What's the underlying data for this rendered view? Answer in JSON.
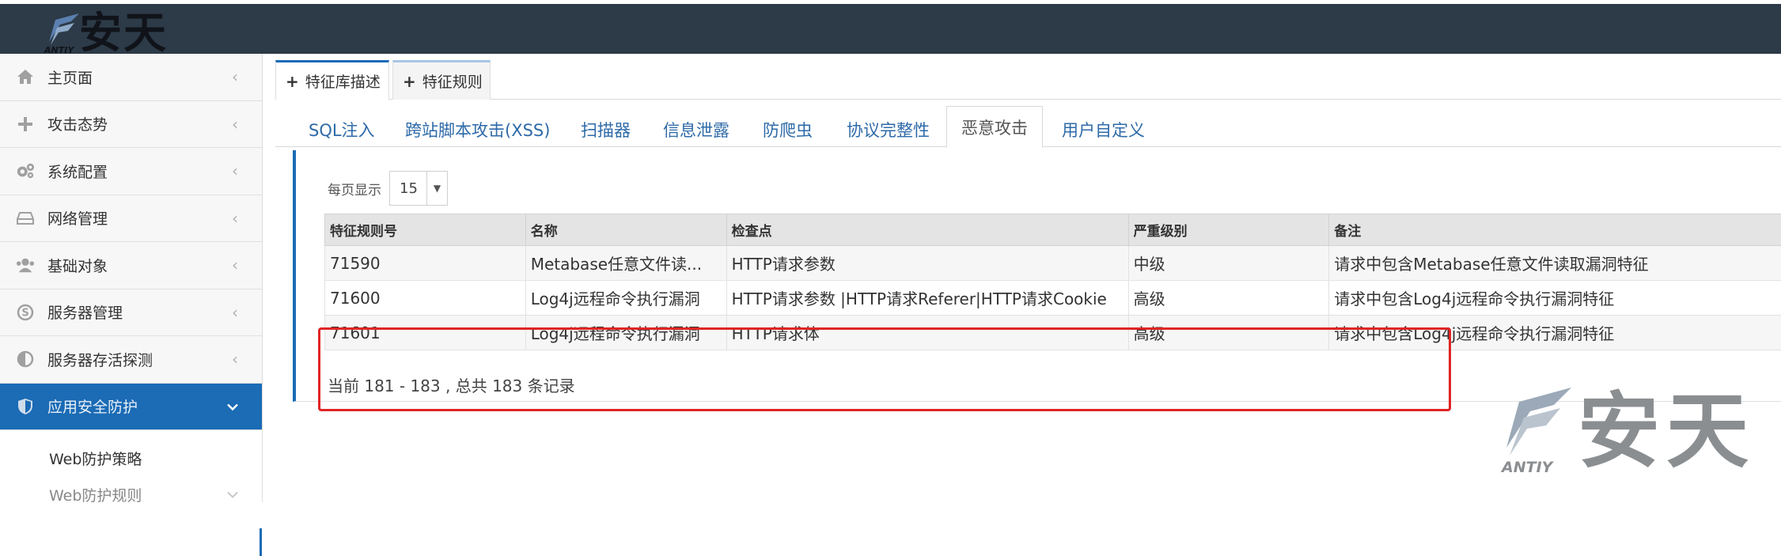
{
  "brand": {
    "logo_text": "安天",
    "logo_sub": "ANTIY"
  },
  "sidebar": {
    "items": [
      {
        "label": "主页面",
        "icon": "home-icon"
      },
      {
        "label": "攻击态势",
        "icon": "plus-icon"
      },
      {
        "label": "系统配置",
        "icon": "gears-icon"
      },
      {
        "label": "网络管理",
        "icon": "hdd-icon"
      },
      {
        "label": "基础对象",
        "icon": "users-icon"
      },
      {
        "label": "服务器管理",
        "icon": "skype-icon"
      },
      {
        "label": "服务器存活探测",
        "icon": "half-circle-icon"
      },
      {
        "label": "应用安全防护",
        "icon": "shield-icon"
      }
    ],
    "sub_items": [
      {
        "label": "Web防护策略"
      },
      {
        "label": "Web防护规则"
      }
    ]
  },
  "top_tabs": [
    {
      "label": "特征库描述"
    },
    {
      "label": "特征规则"
    }
  ],
  "sub_tabs": [
    {
      "label": "SQL注入"
    },
    {
      "label": "跨站脚本攻击(XSS)"
    },
    {
      "label": "扫描器"
    },
    {
      "label": "信息泄露"
    },
    {
      "label": "防爬虫"
    },
    {
      "label": "协议完整性"
    },
    {
      "label": "恶意攻击"
    },
    {
      "label": "用户自定义"
    }
  ],
  "per_page": {
    "label": "每页显示",
    "value": "15"
  },
  "table": {
    "headers": [
      "特征规则号",
      "名称",
      "检查点",
      "严重级别",
      "备注"
    ],
    "rows": [
      [
        "71590",
        "Metabase任意文件读...",
        "HTTP请求参数",
        "中级",
        "请求中包含Metabase任意文件读取漏洞特征"
      ],
      [
        "71600",
        "Log4j远程命令执行漏洞",
        "HTTP请求参数 |HTTP请求Referer|HTTP请求Cookie",
        "高级",
        "请求中包含Log4j远程命令执行漏洞特征"
      ],
      [
        "71601",
        "Log4j远程命令执行漏洞",
        "HTTP请求体",
        "高级",
        "请求中包含Log4j远程命令执行漏洞特征"
      ]
    ]
  },
  "footer": {
    "record_text": "当前 181 - 183 , 总共 183 条记录"
  },
  "watermark": {
    "text": "安天",
    "sub": "ANTIY"
  },
  "colors": {
    "topbar": "#2d3a47",
    "accent": "#1b6bb5",
    "highlight": "#e02424"
  }
}
